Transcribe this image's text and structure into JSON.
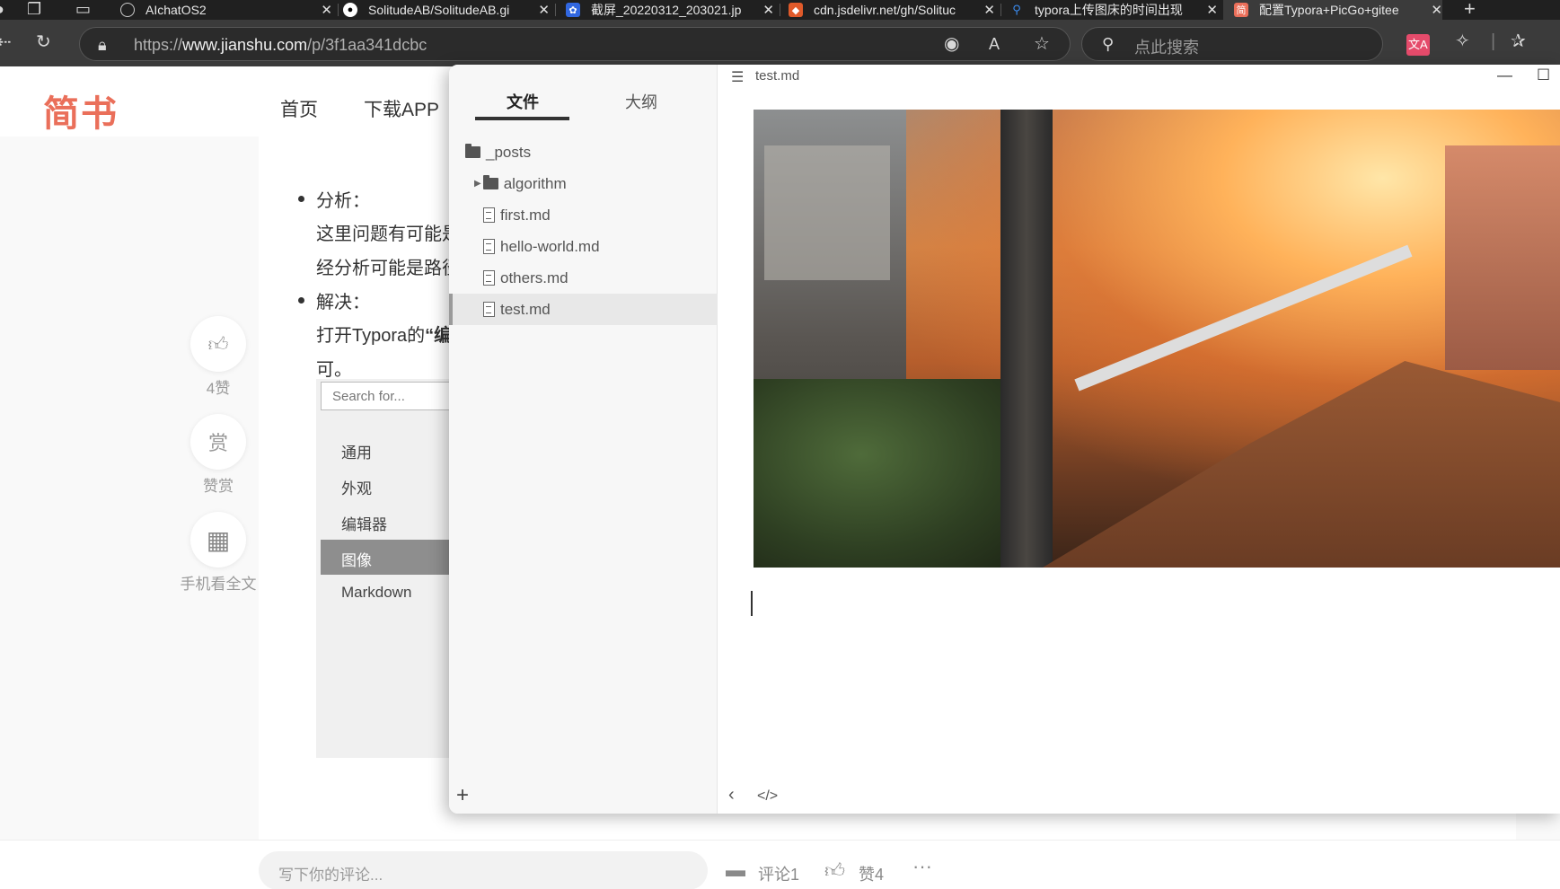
{
  "browser": {
    "tabs": [
      {
        "title": "AIchatOS2",
        "icon": "chatgpt-icon",
        "color": "#202020"
      },
      {
        "title": "SolitudeAB/SolitudeAB.gi",
        "icon": "github-icon",
        "color": "#202020"
      },
      {
        "title": "截屏_20220312_203021.jp",
        "icon": "baidu-paw-icon",
        "color": "#3167e0"
      },
      {
        "title": "cdn.jsdelivr.net/gh/Solituc",
        "icon": "shield-icon",
        "color": "#e05a2a"
      },
      {
        "title": "typora上传图床的时间出现",
        "icon": "search-icon",
        "color": "#202020"
      },
      {
        "title": "配置Typora+PicGo+gitee",
        "icon": "jianshu-icon",
        "color": "#ea6f5a"
      }
    ],
    "active_tab_glyph": "简",
    "new_tab_label": "+",
    "url": "https://www.jianshu.com/p/3f1aa341dcbc",
    "url_host": "www.jianshu.com",
    "search_placeholder": "点此搜索",
    "translate_glyph": "文A"
  },
  "jianshu": {
    "logo": "简书",
    "nav": [
      "首页",
      "下载APP"
    ],
    "sidebar": {
      "like_count": "4赞",
      "reward_glyph": "赏",
      "reward_label": "赞赏",
      "mobile_label": "手机看全文"
    },
    "article": {
      "bullet1_title": "分析：",
      "bullet1_line1": "这里问题有可能是",
      "bullet1_line2": "经分析可能是路径",
      "bullet2_title": "解决：",
      "bullet2_line1_pre": "打开Typora的",
      "bullet2_line1_bold": "“编",
      "bullet2_line2": "可。",
      "settings_search_placeholder": "Search for...",
      "settings_items": [
        "通用",
        "外观",
        "编辑器",
        "图像",
        "Markdown"
      ],
      "settings_active": "图像"
    },
    "footer": {
      "comment_placeholder": "写下你的评论...",
      "comment_count": "评论1",
      "like_count": "赞4",
      "more": "···"
    }
  },
  "typora": {
    "tabs": {
      "files": "文件",
      "outline": "大纲"
    },
    "tree": [
      {
        "name": "_posts",
        "type": "folder",
        "depth": 0
      },
      {
        "name": "algorithm",
        "type": "folder-collapsed",
        "depth": 1
      },
      {
        "name": "first.md",
        "type": "file",
        "depth": 1
      },
      {
        "name": "hello-world.md",
        "type": "file",
        "depth": 1
      },
      {
        "name": "others.md",
        "type": "file",
        "depth": 1
      },
      {
        "name": "test.md",
        "type": "file",
        "depth": 1,
        "selected": true
      }
    ],
    "add_label": "+",
    "filename": "test.md",
    "minimize": "—",
    "maximize": "☐",
    "status_back": "‹",
    "status_source": "</>"
  },
  "colors": {
    "jianshu_brand": "#ea6f5a",
    "browser_dark": "#202020",
    "toolbar": "#3b3b3b"
  }
}
